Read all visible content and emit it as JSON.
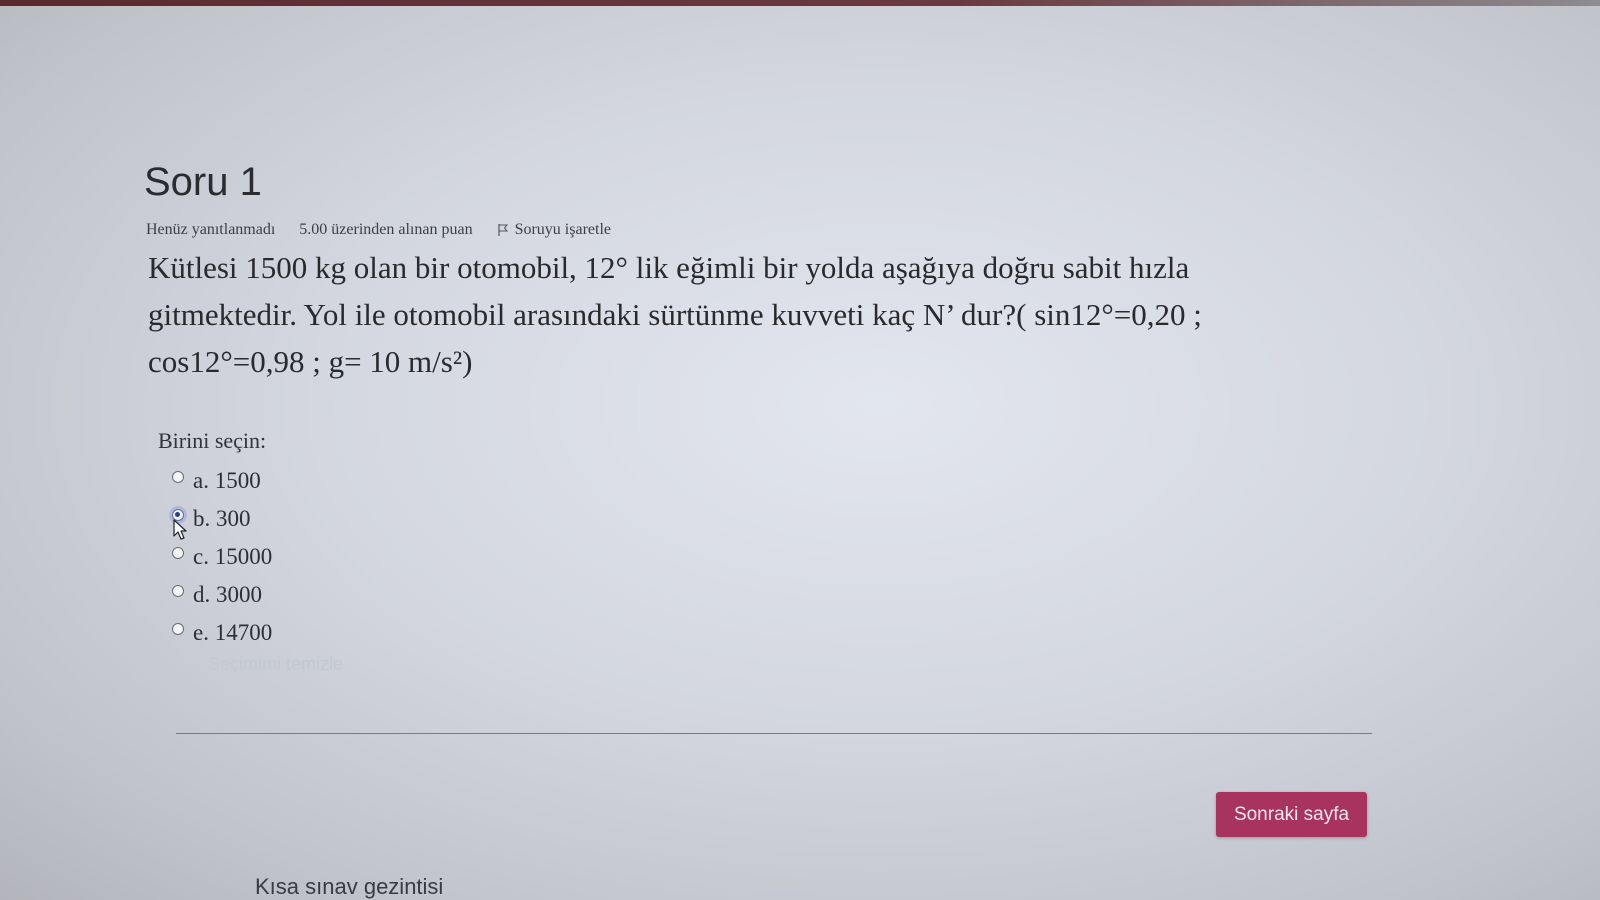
{
  "question": {
    "title": "Soru 1",
    "status": "Henüz yanıtlanmadı",
    "points": "5.00 üzerinden alınan puan",
    "flag_label": "Soruyu işaretle",
    "text": "Kütlesi 1500 kg olan bir otomobil, 12° lik eğimli bir yolda aşağıya doğru sabit hızla gitmektedir. Yol ile otomobil arasındaki sürtünme kuvveti kaç N’ dur?( sin12°=0,20 ; cos12°=0,98  ; g= 10 m/s²)"
  },
  "answer_block": {
    "prompt": "Birini seçin:",
    "options": [
      {
        "label": "a. 1500",
        "selected": false
      },
      {
        "label": "b. 300",
        "selected": true
      },
      {
        "label": "c. 15000",
        "selected": false
      },
      {
        "label": "d. 3000",
        "selected": false
      },
      {
        "label": "e. 14700",
        "selected": false
      }
    ],
    "clear_label": "Seçimimi temizle"
  },
  "footer": {
    "next_button": "Sonraki sayfa",
    "nav_title": "Kısa sınav gezintisi"
  },
  "colors": {
    "accent": "#a9335f",
    "text": "#2a2a2e"
  }
}
